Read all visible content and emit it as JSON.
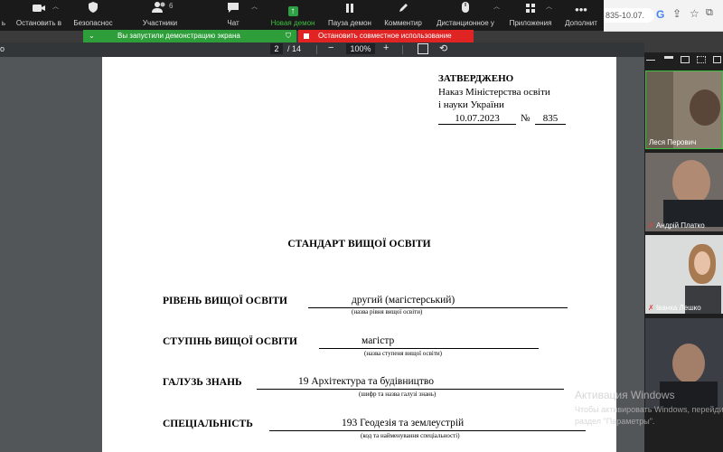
{
  "toolbar": {
    "items": [
      {
        "label": "ь",
        "icon": "unknown-icon"
      },
      {
        "label": "Остановить в",
        "icon": "video-icon"
      },
      {
        "label": "Безопаснос",
        "icon": "shield-icon"
      },
      {
        "label": "Участники",
        "icon": "participants-icon",
        "count": "6"
      },
      {
        "label": "Чат",
        "icon": "chat-icon"
      },
      {
        "label": "Новая демон",
        "icon": "share-screen-icon"
      },
      {
        "label": "Пауза демон",
        "icon": "pause-icon"
      },
      {
        "label": "Комментир",
        "icon": "pencil-icon"
      },
      {
        "label": "Дистанционное у",
        "icon": "mouse-icon"
      },
      {
        "label": "Приложения",
        "icon": "apps-icon"
      },
      {
        "label": "Дополнит",
        "icon": "more-icon"
      }
    ]
  },
  "browser": {
    "url_fragment": "835-10.07."
  },
  "share": {
    "green_banner": "Вы запустили демонстрацию экрана",
    "red_banner": "Остановить совместное использование"
  },
  "pdf": {
    "page_current": "2",
    "page_total": "/ 14",
    "zoom": "100%",
    "left_fragment": "о"
  },
  "document": {
    "approved": "ЗАТВЕРДЖЕНО",
    "order_line1": "Наказ Міністерства освіти",
    "order_line2": "і науки України",
    "order_date": "10.07.2023",
    "order_no_label": "№",
    "order_no": "835",
    "title": "СТАНДАРТ ВИЩОЇ ОСВІТИ",
    "fields": [
      {
        "label": "РІВЕНЬ ВИЩОЇ ОСВІТИ",
        "value": "другий (магістерський)",
        "hint": "(назва рівня вищої освіти)"
      },
      {
        "label": "СТУПІНЬ ВИЩОЇ ОСВІТИ",
        "value": "магістр",
        "hint": "(назва ступеня вищої освіти)"
      },
      {
        "label": "ГАЛУЗЬ ЗНАНЬ",
        "value": "19 Архітектура та будівництво",
        "hint": "(шифр та назва галузі знань)"
      },
      {
        "label": "СПЕЦІАЛЬНІСТЬ",
        "value": "193 Геодезія та землеустрій",
        "hint": "(код та найменування спеціальності)"
      }
    ]
  },
  "participants": [
    {
      "name": "Леся Перович",
      "muted": false
    },
    {
      "name": "Андрій Платко",
      "muted": true
    },
    {
      "name": "Іванка Лешко",
      "muted": true
    },
    {
      "name": "",
      "muted": false
    }
  ],
  "watermark": {
    "line1": "Активация Windows",
    "line2": "Чтобы активировать Windows, перейдите в",
    "line3": "раздел \"Параметры\"."
  }
}
